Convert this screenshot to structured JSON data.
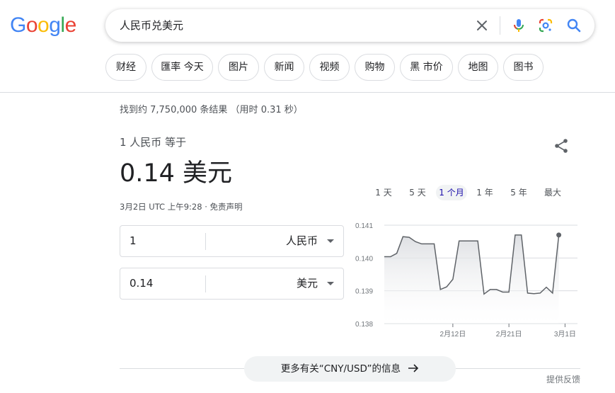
{
  "logo": {
    "text": "Google",
    "letters": [
      {
        "ch": "G",
        "color": "#4285F4"
      },
      {
        "ch": "o",
        "color": "#EA4335"
      },
      {
        "ch": "o",
        "color": "#FBBC05"
      },
      {
        "ch": "g",
        "color": "#4285F4"
      },
      {
        "ch": "l",
        "color": "#34A853"
      },
      {
        "ch": "e",
        "color": "#EA4335"
      }
    ]
  },
  "search": {
    "query": "人民币兑美元"
  },
  "chips": [
    "财经",
    "匯率 今天",
    "图片",
    "新闻",
    "视频",
    "购物",
    "黑 市价",
    "地图",
    "图书"
  ],
  "stats": "找到约 7,750,000 条结果 （用时 0.31 秒）",
  "converter": {
    "from_desc": "1 人民币 等于",
    "result": "0.14 美元",
    "timestamp": "3月2日 UTC 上午9:28 · 免责声明",
    "from_value": "1",
    "from_currency": "人民币",
    "to_value": "0.14",
    "to_currency": "美元"
  },
  "ranges": [
    {
      "label": "1 天",
      "active": false
    },
    {
      "label": "5 天",
      "active": false
    },
    {
      "label": "1 个月",
      "active": true
    },
    {
      "label": "1 年",
      "active": false
    },
    {
      "label": "5 年",
      "active": false
    },
    {
      "label": "最大",
      "active": false
    }
  ],
  "chart_data": {
    "type": "area",
    "y_ticks": [
      "0.141",
      "0.140",
      "0.139",
      "0.138"
    ],
    "ylim": [
      0.138,
      0.141
    ],
    "x_ticks": [
      {
        "label": "2月12日",
        "x": 11
      },
      {
        "label": "2月21日",
        "x": 20
      },
      {
        "label": "3月1日",
        "x": 29
      }
    ],
    "x_range": [
      0,
      31
    ],
    "values": [
      [
        0,
        0.14004
      ],
      [
        1,
        0.14004
      ],
      [
        2,
        0.14014
      ],
      [
        3,
        0.14065
      ],
      [
        4,
        0.14063
      ],
      [
        5,
        0.1405
      ],
      [
        6,
        0.14043
      ],
      [
        7,
        0.14043
      ],
      [
        8,
        0.14043
      ],
      [
        9,
        0.13904
      ],
      [
        10,
        0.13912
      ],
      [
        11,
        0.13935
      ],
      [
        12,
        0.14052
      ],
      [
        13,
        0.14052
      ],
      [
        14,
        0.14052
      ],
      [
        15,
        0.14052
      ],
      [
        16,
        0.1389
      ],
      [
        17,
        0.13904
      ],
      [
        18,
        0.13904
      ],
      [
        19,
        0.13896
      ],
      [
        20,
        0.13896
      ],
      [
        21,
        0.1407
      ],
      [
        22,
        0.1407
      ],
      [
        23,
        0.13893
      ],
      [
        24,
        0.13891
      ],
      [
        25,
        0.13893
      ],
      [
        26,
        0.13911
      ],
      [
        27,
        0.13893
      ],
      [
        28,
        0.1407
      ]
    ],
    "line_color": "#5f6368",
    "fill_color": "#e8eaed"
  },
  "more_info": "更多有关“CNY/USD”的信息",
  "feedback": "提供反馈"
}
